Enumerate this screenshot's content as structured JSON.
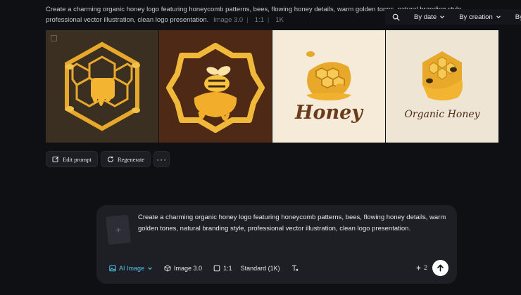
{
  "prompt_header": {
    "text": "Create a charming organic honey logo featuring honeycomb patterns, bees, flowing honey details, warm golden tones, natural branding style, professional vector illustration, clean logo presentation.",
    "model": "Image 3.0",
    "ratio": "1:1",
    "resolution": "1K"
  },
  "top_toolbar": {
    "by_date": "By date",
    "by_creation": "By creation",
    "by_category": "By cat"
  },
  "images": {
    "honey_word": "Honey",
    "organic_honey_word": "Organic Honey"
  },
  "actions": {
    "edit_prompt": "Edit prompt",
    "regenerate": "Regenerate",
    "more": "···"
  },
  "composer": {
    "text": "Create a charming organic honey logo featuring honeycomb patterns, bees, flowing honey details, warm golden tones, natural branding style, professional vector illustration, clean logo presentation.",
    "upload_plus": "+",
    "tools": {
      "ai_image": "AI Image",
      "model": "Image 3.0",
      "ratio": "1:1",
      "quality": "Standard (1K)"
    },
    "credits": "2"
  },
  "colors": {
    "background": "#0f1014",
    "accent_ai": "#4fc3ea",
    "honey_gold": "#e8a82a"
  }
}
